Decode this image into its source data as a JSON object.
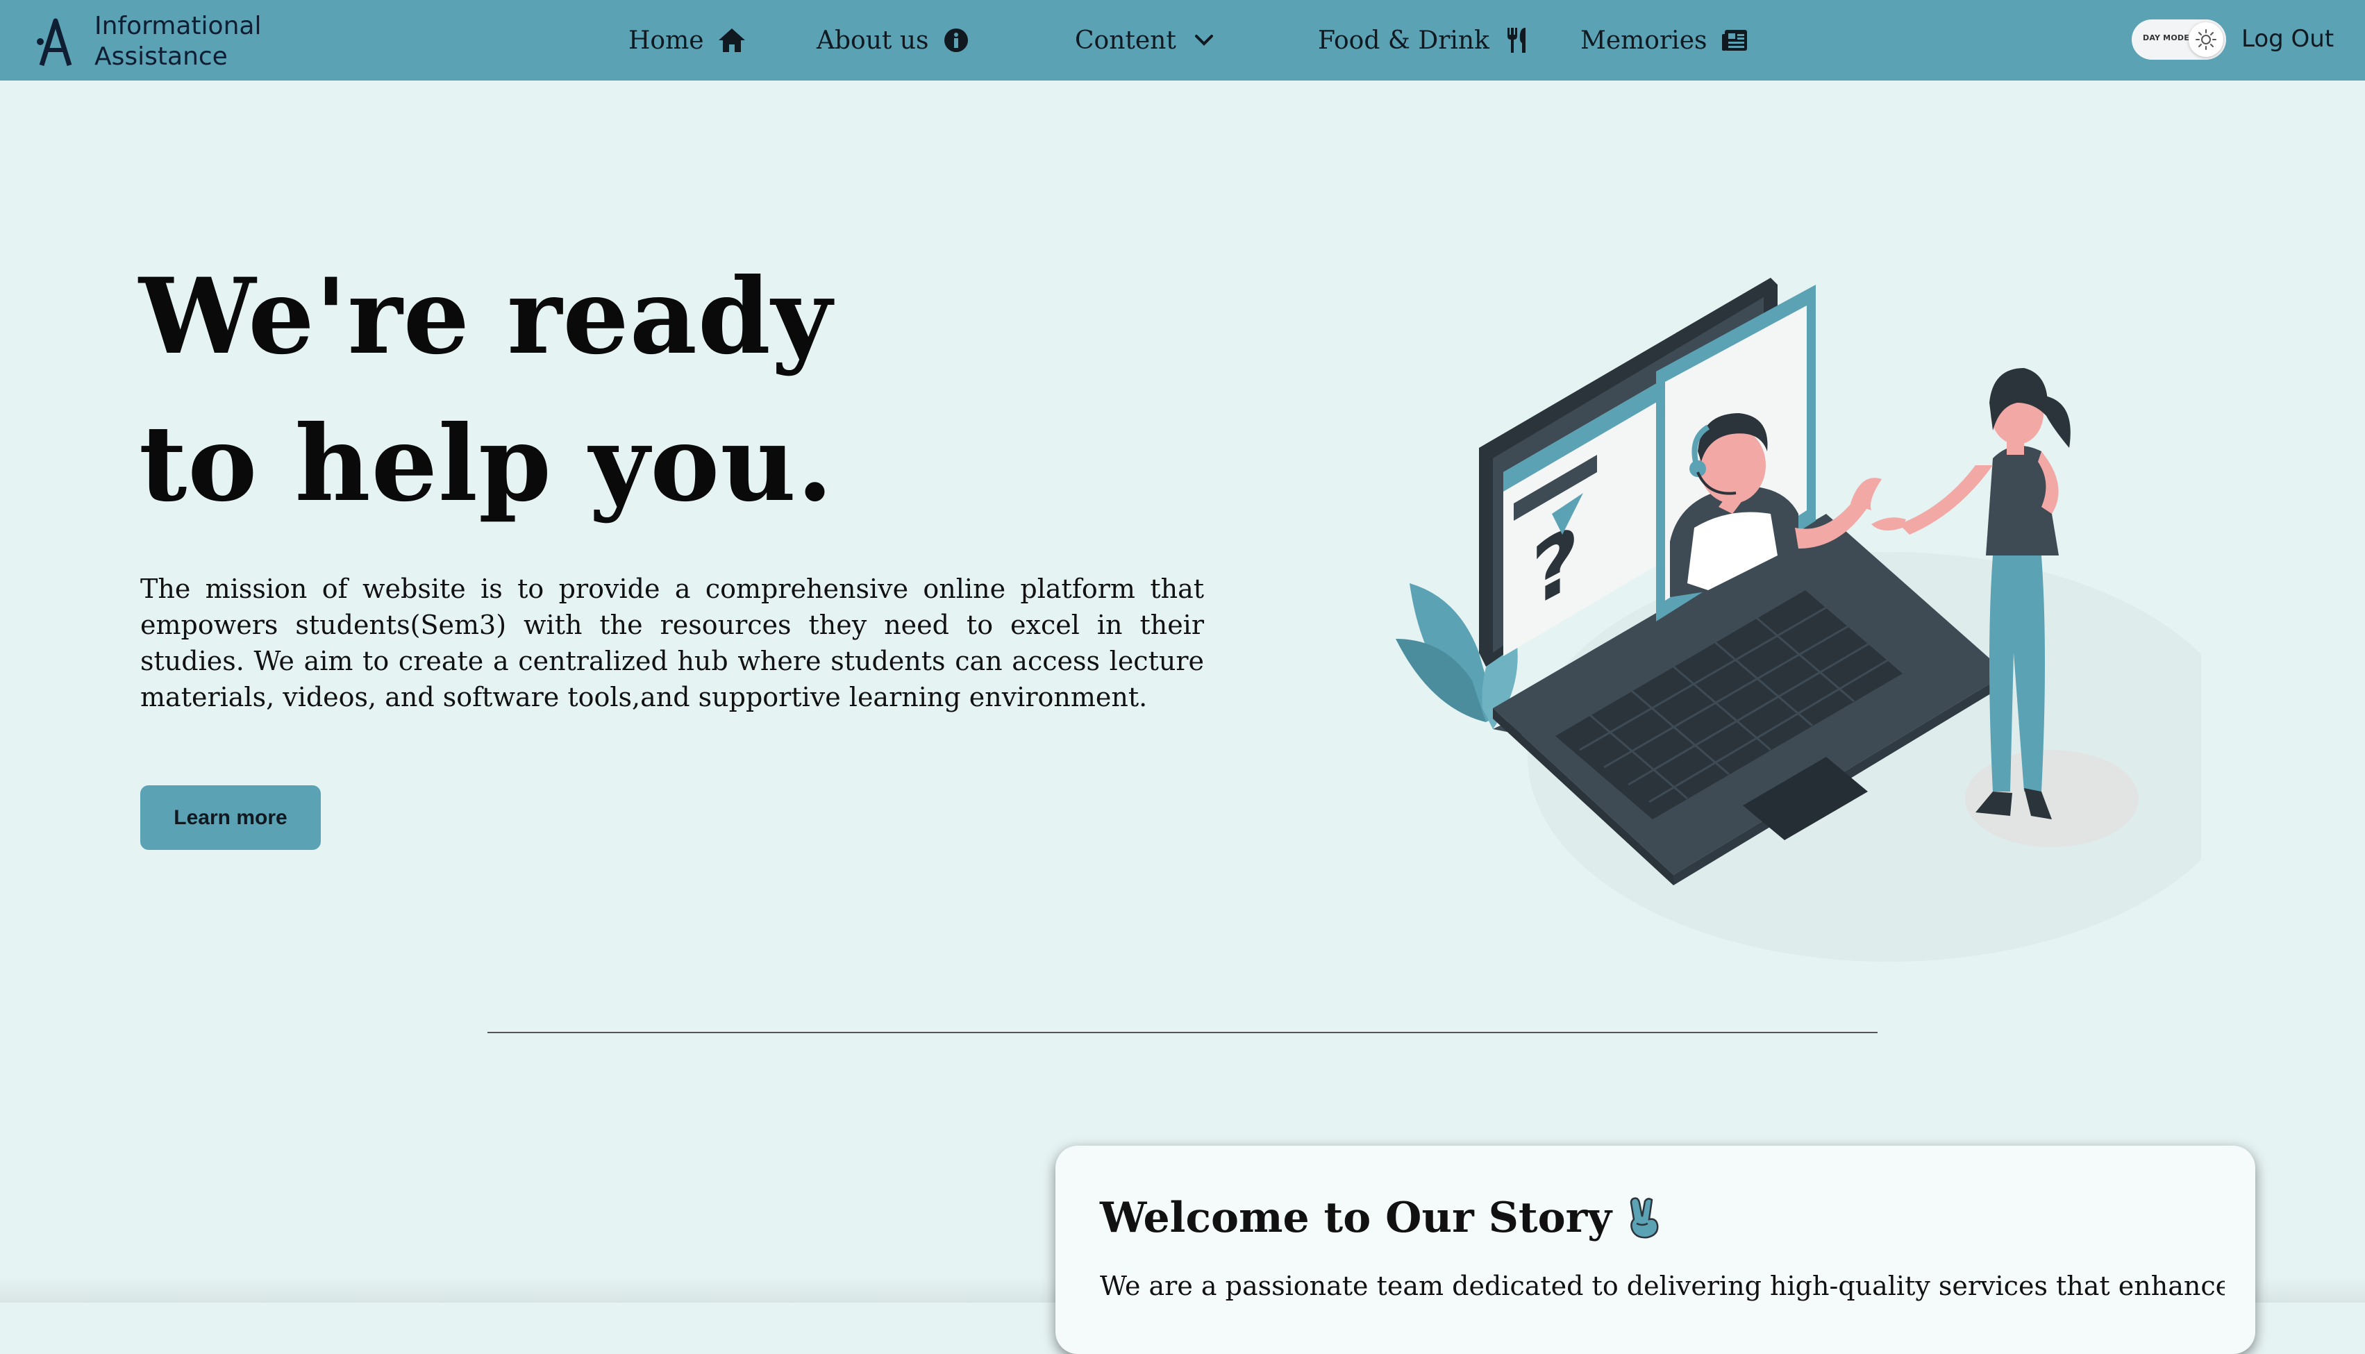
{
  "brand": {
    "line1": "Informational",
    "line2": "Assistance",
    "logo_icon": "a-logo-icon"
  },
  "nav": {
    "home": {
      "label": "Home",
      "icon": "home-icon"
    },
    "about": {
      "label": "About us",
      "icon": "info-circle-icon"
    },
    "content": {
      "label": "Content",
      "icon": "chevron-down-icon"
    },
    "food": {
      "label": "Food & Drink",
      "icon": "utensils-icon"
    },
    "memories": {
      "label": "Memories",
      "icon": "newspaper-icon"
    },
    "day_mode": {
      "label": "DAY MODE",
      "icon": "sun-icon"
    },
    "logout": "Log Out"
  },
  "hero": {
    "title_line1": "We're ready",
    "title_line2": "to help you.",
    "description": "The mission of website is to provide a comprehensive online platform that empowers students(Sem3) with the resources they need to excel in their studies. We aim to create a centralized hub where students can access lecture materials, videos, and software tools,and supportive learning environment.",
    "button": "Learn more",
    "illustration": "online-support-illustration"
  },
  "story": {
    "title": "Welcome to Our Story",
    "title_icon": "victory-hand-icon",
    "text": "We are a passionate team dedicated to delivering high-quality services that enhance"
  },
  "colors": {
    "nav_bg": "#5ba2b4",
    "page_bg": "#e6f3f3",
    "accent": "#5ba2b4",
    "dark_text": "#101820"
  }
}
